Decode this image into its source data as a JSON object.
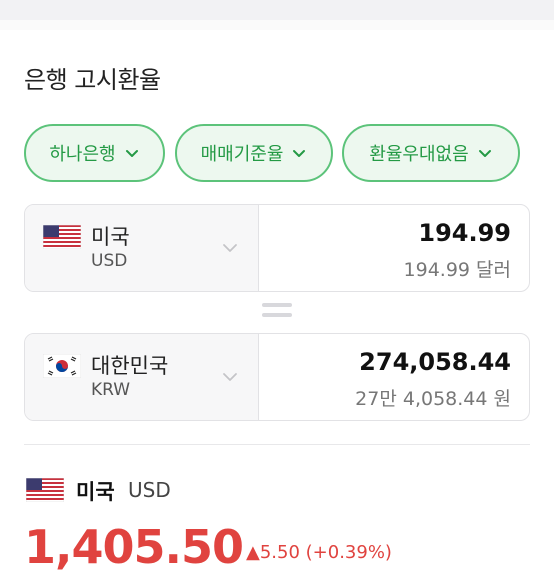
{
  "section": {
    "title": "은행 고시환율"
  },
  "filters": [
    {
      "label": "하나은행"
    },
    {
      "label": "매매기준율"
    },
    {
      "label": "환율우대없음"
    }
  ],
  "from": {
    "country": "미국",
    "code": "USD",
    "amount": "194.99",
    "amount_text": "194.99 달러"
  },
  "to": {
    "country": "대한민국",
    "code": "KRW",
    "amount": "274,058.44",
    "amount_text": "27만 4,058.44 원"
  },
  "rate": {
    "country": "미국",
    "code": "USD",
    "value": "1,405.50",
    "change": "▲5.50 (+0.39%)"
  },
  "colors": {
    "accent": "#249a45",
    "chip_bg": "#edf8ef",
    "up": "#e0433f"
  }
}
